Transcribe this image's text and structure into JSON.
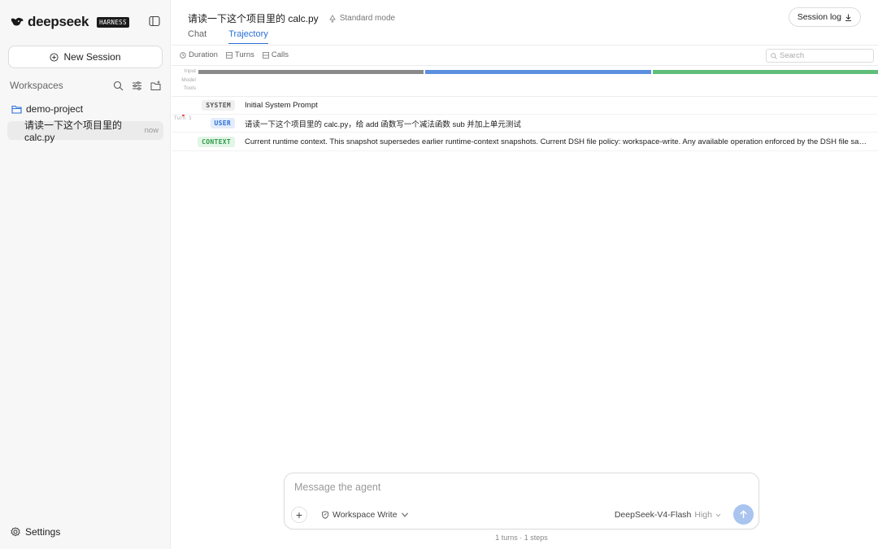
{
  "brand": {
    "name": "deepseek",
    "badge": "HARNESS"
  },
  "sidebar": {
    "new_session_label": "New Session",
    "workspaces_title": "Workspaces",
    "project_name": "demo-project",
    "session": {
      "title": "请读一下这个项目里的 calc.py",
      "time": "now"
    },
    "settings_label": "Settings"
  },
  "header": {
    "title": "请读一下这个项目里的 calc.py",
    "mode": "Standard mode",
    "session_log_label": "Session log",
    "tabs": [
      {
        "label": "Chat",
        "active": false
      },
      {
        "label": "Trajectory",
        "active": true
      }
    ]
  },
  "toolbar": {
    "duration_label": "Duration",
    "turns_label": "Turns",
    "calls_label": "Calls",
    "search_placeholder": "Search"
  },
  "timeline": {
    "lane_labels": [
      "Input",
      "Model",
      "Tools"
    ],
    "segments": [
      {
        "color": "#8a8a8a"
      },
      {
        "color": "#5b8fe0"
      },
      {
        "color": "#5fbf7a"
      }
    ],
    "turn_label": "Turn 1"
  },
  "steps": [
    {
      "tag": "SYSTEM",
      "kind": "system",
      "content": "Initial System Prompt"
    },
    {
      "tag": "USER",
      "kind": "user",
      "content": "请读一下这个项目里的 calc.py，给 add 函数写一个减法函数 sub 并加上单元测试"
    },
    {
      "tag": "CONTEXT",
      "kind": "context",
      "content": "Current runtime context. This snapshot supersedes earlier runtime-context snapshots. Current DSH file policy: workspace-write. Any available operation enforced by the DSH file sandbox may…"
    }
  ],
  "composer": {
    "placeholder": "Message the agent",
    "permission_label": "Workspace Write",
    "model_name": "DeepSeek-V4-Flash",
    "effort": "High"
  },
  "status": "1 turns · 1 steps",
  "colors": {
    "accent": "#2b6fd6",
    "send": "#a9c4ee"
  }
}
